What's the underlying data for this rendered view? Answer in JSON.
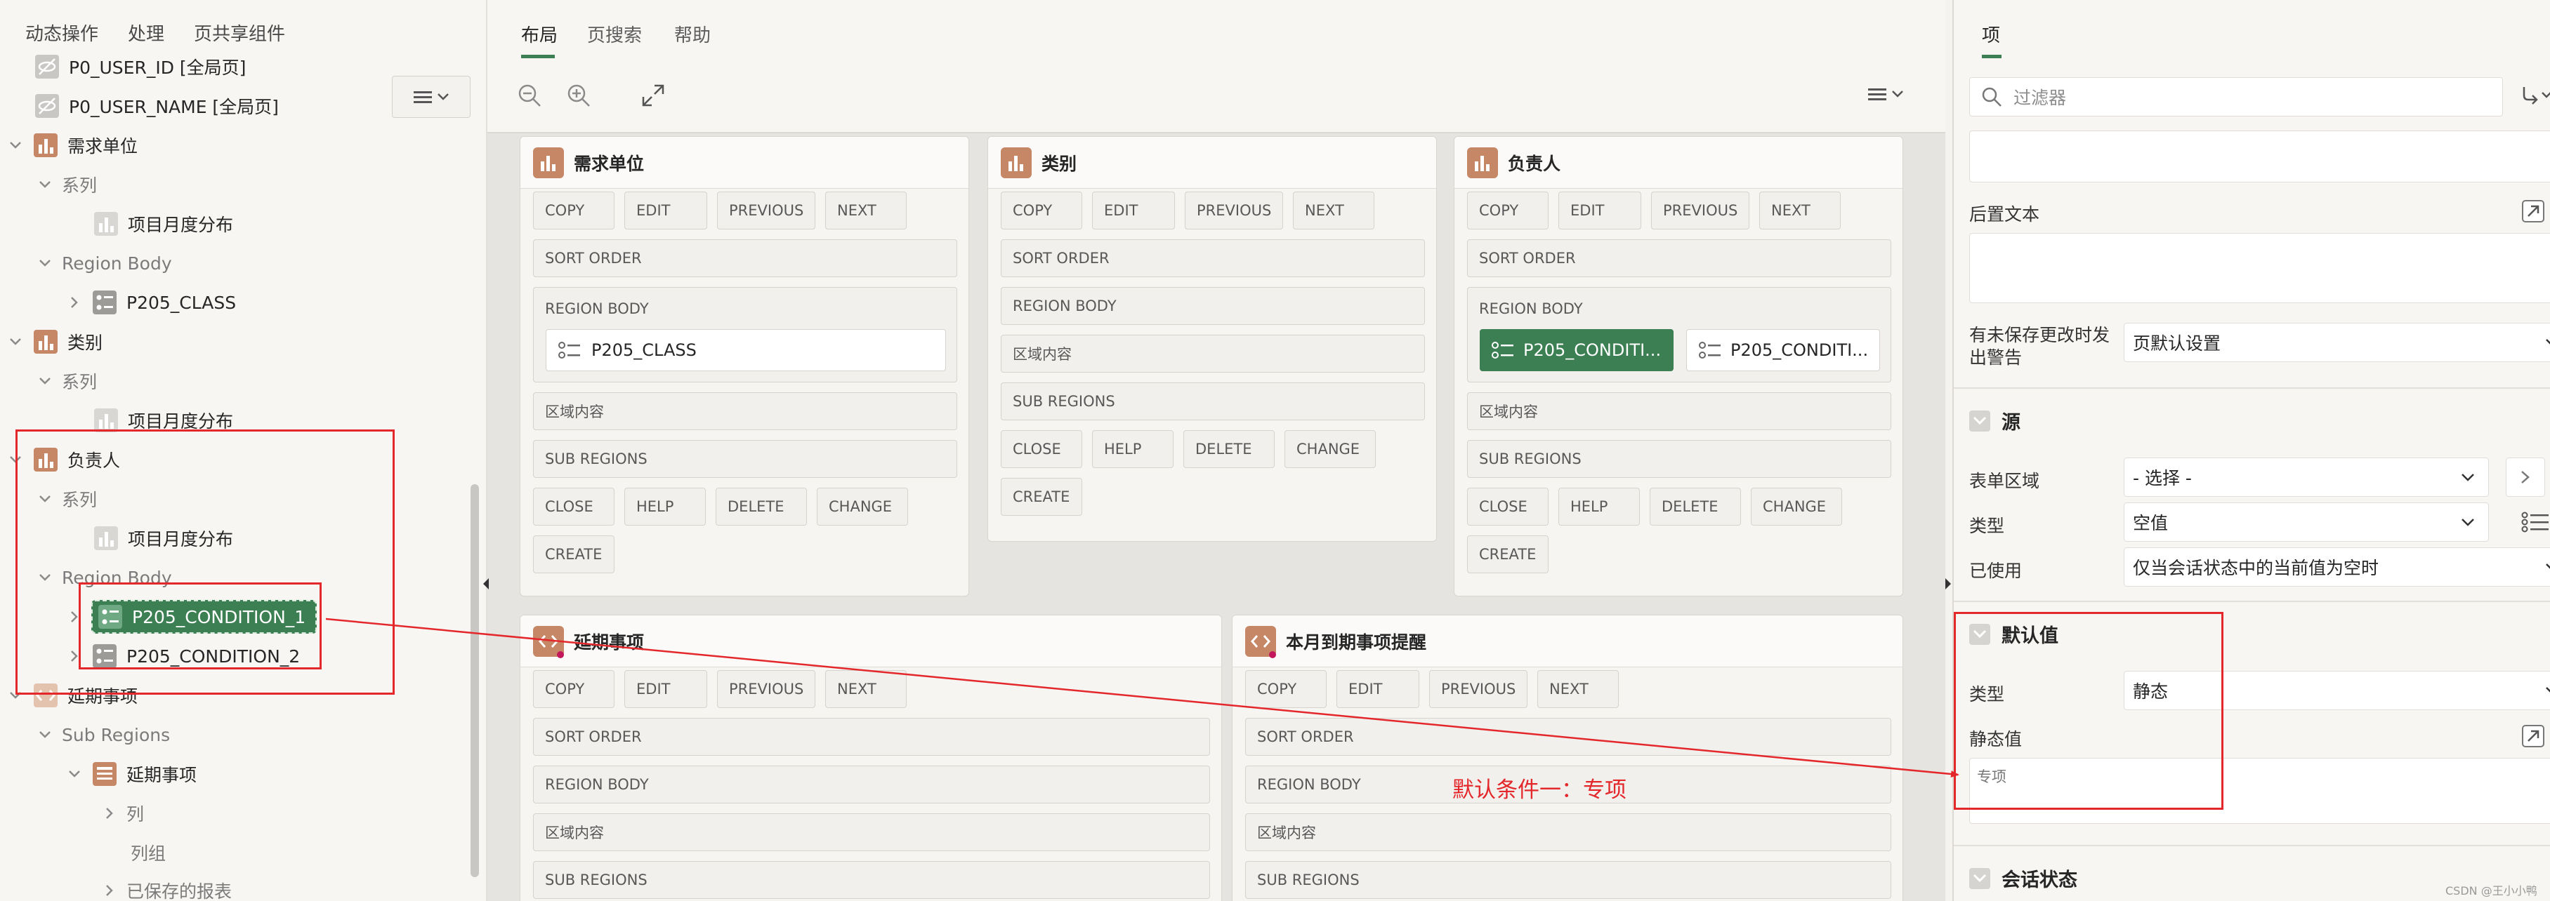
{
  "left_tabs": [
    "动态操作",
    "处理",
    "页共享组件"
  ],
  "tree": {
    "p0_user_id": "P0_USER_ID [全局页]",
    "p0_user_name": "P0_USER_NAME [全局页]",
    "xuqiu": "需求单位",
    "xilie": "系列",
    "xiangmu": "项目月度分布",
    "region_body": "Region Body",
    "p205_class": "P205_CLASS",
    "leibie": "类别",
    "fuzeren": "负责人",
    "cond1": "P205_CONDITION_1",
    "cond2": "P205_CONDITION_2",
    "yanqi": "延期事项",
    "sub_regions": "Sub Regions",
    "lie": "列",
    "liezu": "列组",
    "saved_reports": "已保存的报表"
  },
  "mid_tabs": [
    "布局",
    "页搜索",
    "帮助"
  ],
  "cards": {
    "xuqiu_title": "需求单位",
    "leibie_title": "类别",
    "fuzeren_title": "负责人",
    "yanqi_title": "延期事项",
    "benyue_title": "本月到期事项提醒",
    "copy": "COPY",
    "edit": "EDIT",
    "previous": "PREVIOUS",
    "next": "NEXT",
    "sort_order": "SORT ORDER",
    "region_body": "REGION BODY",
    "region_content": "区域内容",
    "sub_regions": "SUB REGIONS",
    "close": "CLOSE",
    "help": "HELP",
    "delete": "DELETE",
    "change": "CHANGE",
    "create": "CREATE",
    "p205_class": "P205_CLASS",
    "cond1_trunc": "P205_CONDITI...",
    "cond2_trunc": "P205_CONDITI..."
  },
  "annotation": "默认条件一：专项",
  "right": {
    "tab": "项",
    "filter_placeholder": "过滤器",
    "post_text_label": "后置文本",
    "warn_label_1": "有未保存更改时发",
    "warn_label_2": "出警告",
    "warn_value": "页默认设置",
    "source_section": "源",
    "form_region_label": "表单区域",
    "form_region_value": "- 选择 -",
    "type_label": "类型",
    "type_value": "空值",
    "used_label": "已使用",
    "used_value": "仅当会话状态中的当前值为空时",
    "default_section": "默认值",
    "default_type_label": "类型",
    "default_type_value": "静态",
    "static_label": "静态值",
    "static_value": "专项",
    "session_section": "会话状态"
  },
  "watermark": "CSDN @王小小鸭",
  "colors": {
    "accent_green": "#3b7f52",
    "region_icon": "#c58766",
    "annotation_red": "#e4272b"
  }
}
